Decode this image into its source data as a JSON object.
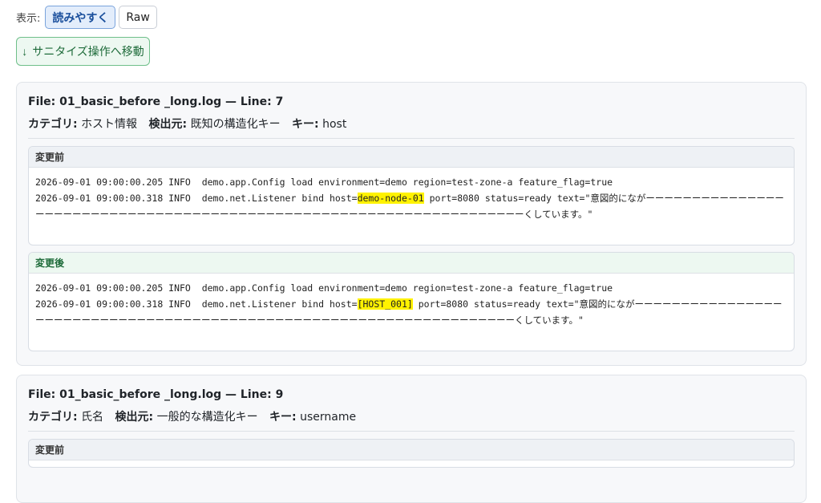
{
  "view": {
    "label": "表示:",
    "readable_label": "読みやすく",
    "raw_label": "Raw"
  },
  "jump": {
    "label": "サニタイズ操作へ移動",
    "icon": "arrow-down-icon"
  },
  "labels": {
    "category": "カテゴリ:",
    "source": "検出元:",
    "key": "キー:",
    "before": "変更前",
    "after": "変更後"
  },
  "findings": [
    {
      "file_line": "File: 01_basic_before _long.log — Line: 7",
      "category": "ホスト情報",
      "source": "既知の構造化キー",
      "key": "host",
      "before_line1": "2026-09-01 09:00:00.205 INFO  demo.app.Config load environment=demo region=test-zone-a feature_flag=true",
      "before_line2_pre": "2026-09-01 09:00:00.318 INFO  demo.net.Listener bind host=",
      "before_value": "demo-node-01",
      "before_line2_post": " port=8080 status=ready text=\"意図的にながーーーーーーーーーーーーーーーーーーーーーーーーーーーーーーーーーーーーーーーーーーーーーーーーーーーーーーーーーーーーーーーーーーーーくしています。\"",
      "after_line1": "2026-09-01 09:00:00.205 INFO  demo.app.Config load environment=demo region=test-zone-a feature_flag=true",
      "after_line2_pre": "2026-09-01 09:00:00.318 INFO  demo.net.Listener bind host=",
      "after_value": "[HOST_001]",
      "after_line2_post": " port=8080 status=ready text=\"意図的にながーーーーーーーーーーーーーーーーーーーーーーーーーーーーーーーーーーーーーーーーーーーーーーーーーーーーーーーーーーーーーーーーーーーーくしています。\""
    },
    {
      "file_line": "File: 01_basic_before _long.log — Line: 9",
      "category": "氏名",
      "source": "一般的な構造化キー",
      "key": "username"
    }
  ]
}
